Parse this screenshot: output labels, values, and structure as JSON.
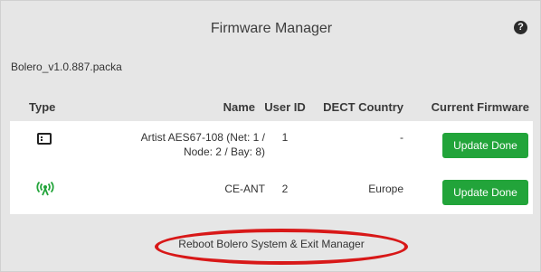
{
  "dialog": {
    "title": "Firmware Manager",
    "help_icon": "question-circle-icon",
    "help_glyph": "?"
  },
  "file_name": "Bolero_v1.0.887.packa",
  "table": {
    "columns": [
      "Type",
      "Name",
      "User ID",
      "DECT Country",
      "Current Firmware"
    ],
    "rows": [
      {
        "type_icon": "beltpack-icon",
        "name_line1": "Artist AES67-108 (Net: 1 /",
        "name_line2": "Node: 2 / Bay: 8)",
        "user_id": "1",
        "dect_country": "-",
        "firmware": "Update Done"
      },
      {
        "type_icon": "antenna-icon",
        "name_line1": "CE-ANT",
        "name_line2": "",
        "user_id": "2",
        "dect_country": "Europe",
        "firmware": "Update Done"
      }
    ]
  },
  "footer": {
    "reboot_label": "Reboot Bolero System & Exit Manager"
  },
  "colors": {
    "accent": "#22a43a",
    "highlight_oval": "#d81818"
  }
}
